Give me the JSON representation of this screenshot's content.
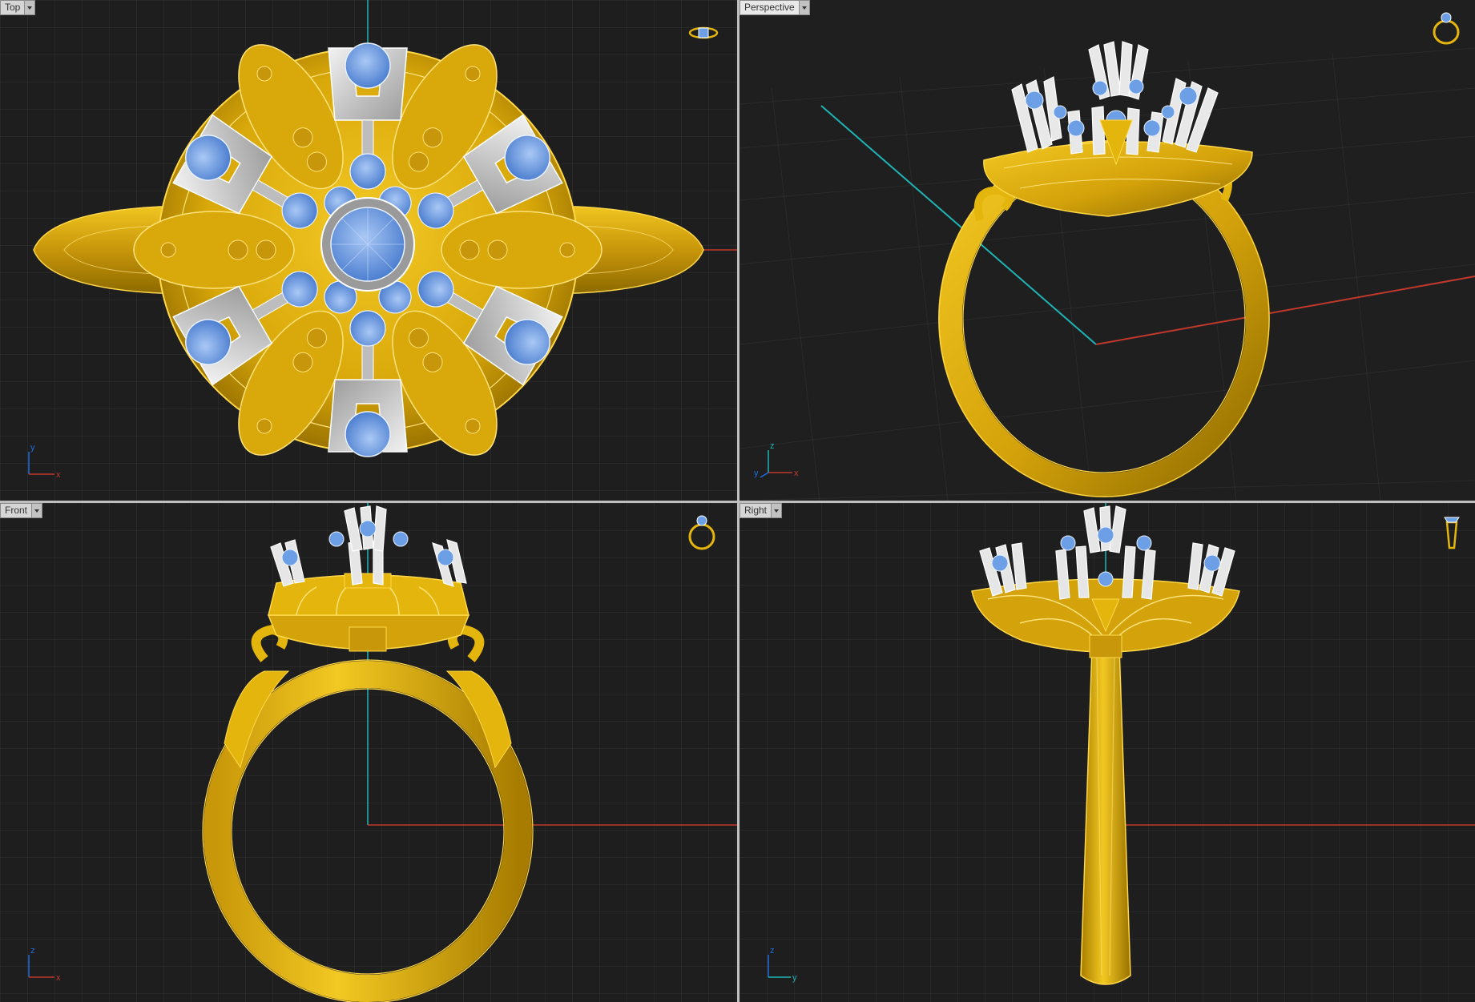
{
  "viewports": {
    "top": {
      "label": "Top",
      "axis_h": "x",
      "axis_v": "y"
    },
    "persp": {
      "label": "Perspective",
      "axis_h": "x",
      "axis_v": "z",
      "axis_d": "y"
    },
    "front": {
      "label": "Front",
      "axis_h": "x",
      "axis_v": "z"
    },
    "right": {
      "label": "Right",
      "axis_h": "y",
      "axis_v": "z"
    }
  },
  "colors": {
    "background": "#1e1e1f",
    "grid": "#2c2c2e",
    "gold": "#e4b50c",
    "gold_dark": "#a47c00",
    "gold_line": "#ffd84a",
    "silver": "#cfcfcf",
    "gem": "#6d9fe6",
    "axis_x": "#c0392b",
    "axis_y": "#1fb5b5",
    "axis_z": "#1fb5b5"
  },
  "icons": {
    "view_thumbnail": "ring-thumbnail-icon",
    "menu_arrow": "chevron-down-icon"
  }
}
